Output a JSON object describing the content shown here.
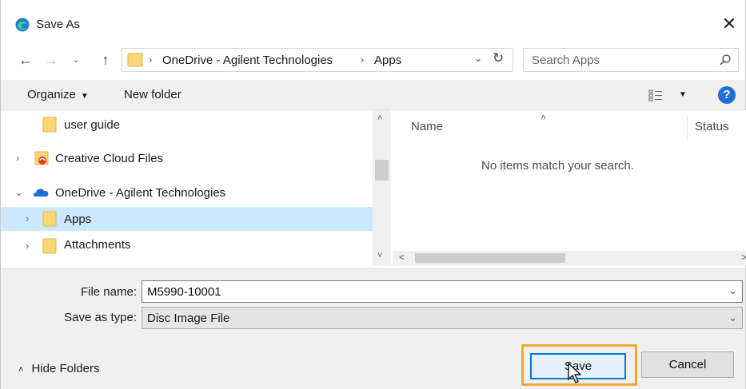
{
  "window": {
    "title": "Save As",
    "close_symbol": "✕",
    "app_icon": "edge-icon"
  },
  "address": {
    "back": "←",
    "forward": "→",
    "recent": "⌄",
    "up": "↑",
    "separator": "›",
    "segments": [
      "OneDrive - Agilent Technologies",
      "Apps"
    ],
    "dropdown": "⌄",
    "refresh": "↻"
  },
  "search": {
    "placeholder": "Search Apps"
  },
  "toolbar": {
    "organize_label": "Organize",
    "organize_caret": "▼",
    "new_folder_label": "New folder",
    "view_caret": "▼",
    "help_label": "?"
  },
  "nav_tree": {
    "items": [
      {
        "label": "user guide",
        "chevron": "",
        "icon": "folder-icon"
      },
      {
        "label": "Creative Cloud Files",
        "chevron": "›",
        "icon": "creative-cloud-folder-icon"
      },
      {
        "label": "OneDrive - Agilent Technologies",
        "chevron": "⌄",
        "icon": "onedrive-cloud-icon"
      },
      {
        "label": "Apps",
        "chevron": "›",
        "icon": "folder-icon",
        "selected": true
      },
      {
        "label": "Attachments",
        "chevron": "›",
        "icon": "folder-icon"
      }
    ],
    "scroll_up": "˄",
    "scroll_down": "˅"
  },
  "content": {
    "sort_caret": "˄",
    "columns": [
      "Name",
      "Status"
    ],
    "empty_message": "No items match your search.",
    "scroll_left": "<",
    "scroll_right": ">"
  },
  "form": {
    "file_name_label": "File name:",
    "file_name_value": "M5990-10001",
    "file_name_caret": "⌄",
    "save_type_label": "Save as type:",
    "save_type_value": "Disc Image File",
    "save_type_caret": "⌄"
  },
  "footer": {
    "hide_folders_caret": "˄",
    "hide_folders_label": "Hide Folders",
    "save_label": "Save",
    "cancel_label": "Cancel"
  },
  "colors": {
    "accent": "#0078d7",
    "selection": "#cce8ff",
    "highlight": "#f0a830",
    "folder": "#f8d775"
  }
}
